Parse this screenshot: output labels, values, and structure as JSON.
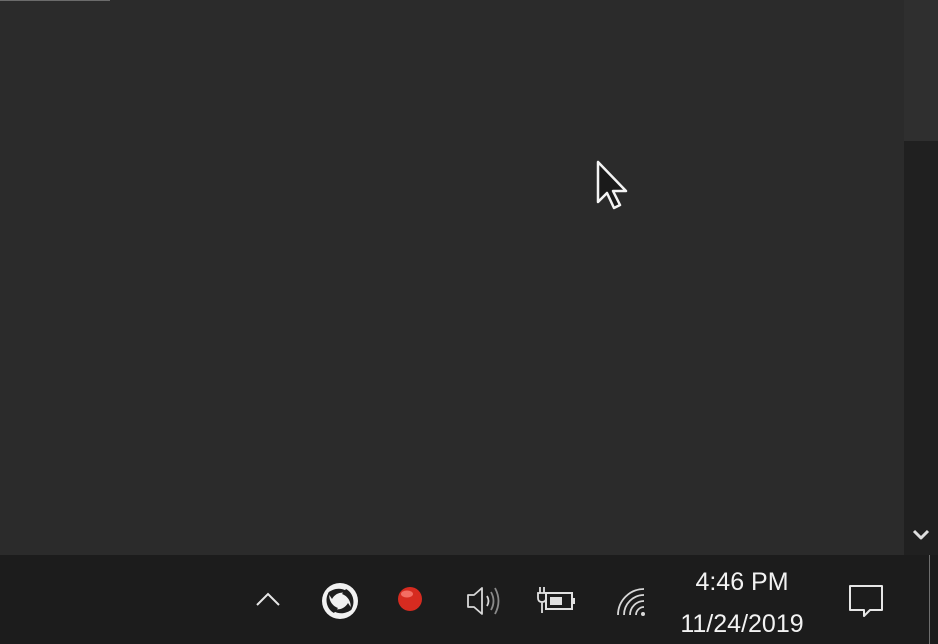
{
  "taskbar": {
    "tray": {
      "show_hidden_icon": "chevron-up-icon",
      "app_icon": "swirl-logo-icon",
      "record_icon": "record-dot-icon",
      "volume_icon": "speaker-icon",
      "battery_icon": "battery-charging-icon",
      "wifi_icon": "wifi-icon",
      "notification_icon": "action-center-icon"
    },
    "clock": {
      "time": "4:46 PM",
      "date": "11/24/2019"
    }
  },
  "colors": {
    "background": "#2b2b2b",
    "taskbar": "#1c1c1c",
    "record": "#d62b20",
    "text": "#f2f2f2"
  }
}
